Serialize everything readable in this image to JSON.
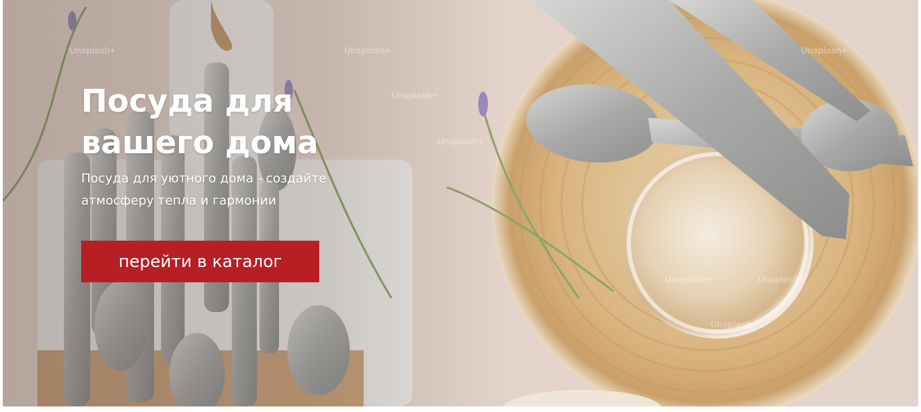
{
  "hero": {
    "title_line1": "Посуда для",
    "title_line2": "вашего дома",
    "subtitle_line1": "Посуда для уютного дома - создайте",
    "subtitle_line2": "атмосферу тепла и гармонии",
    "cta_label": "перейти в каталог"
  },
  "watermark": {
    "text": "Unsplash+"
  },
  "colors": {
    "cta_background": "#b71f24",
    "text": "#ffffff",
    "backdrop": "#e6d6ce"
  }
}
